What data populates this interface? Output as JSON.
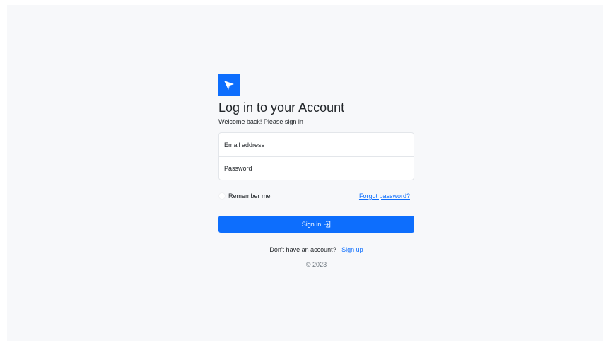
{
  "header": {
    "logo_icon": "paper-plane-icon",
    "title": "Log in to your Account",
    "subtitle": "Welcome back! Please sign in"
  },
  "form": {
    "email_placeholder": "Email address",
    "password_placeholder": "Password",
    "remember_label": "Remember me",
    "forgot_label": "Forgot password?",
    "signin_label": "Sign in",
    "signin_icon": "box-arrow-in-right-icon"
  },
  "footer": {
    "no_account_text": "Don't have an account?",
    "signup_label": "Sign up",
    "copyright": "© 2023"
  },
  "colors": {
    "accent": "#0d6efd",
    "background": "#f7f8fa"
  }
}
